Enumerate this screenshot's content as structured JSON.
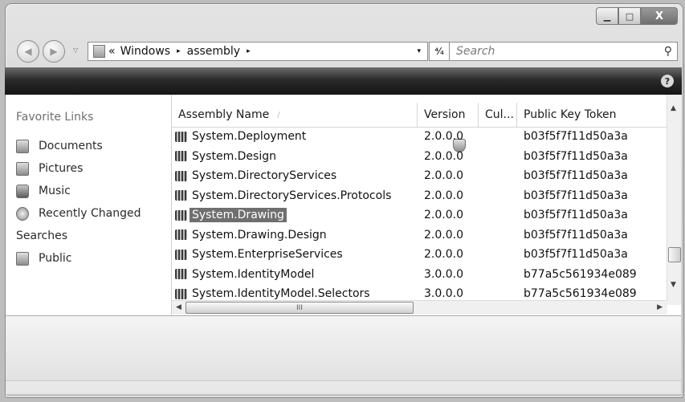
{
  "window": {
    "controls": {
      "minimize": "▁",
      "maximize": "□",
      "close": "X"
    }
  },
  "nav": {
    "back_glyph": "◀",
    "forward_glyph": "▶",
    "recent_glyph": "▽",
    "address": {
      "prefix": "«",
      "crumbs": [
        "Windows",
        "assembly"
      ],
      "separator": "▸",
      "dropdown": "▾"
    },
    "refresh_glyph": "⁴⁄₄",
    "search": {
      "placeholder": "Search",
      "icon": "⚲"
    }
  },
  "toolbar": {
    "help": "?"
  },
  "sidebar": {
    "title": "Favorite Links",
    "items": [
      {
        "label": "Documents",
        "icon": "documents-icon"
      },
      {
        "label": "Pictures",
        "icon": "pictures-icon"
      },
      {
        "label": "Music",
        "icon": "music-icon"
      },
      {
        "label": "Recently Changed",
        "icon": "recently-changed-icon"
      },
      {
        "label": "Searches",
        "icon": "searches-icon"
      },
      {
        "label": "Public",
        "icon": "public-icon"
      }
    ]
  },
  "list": {
    "columns": [
      "Assembly Name",
      "Version",
      "Cul...",
      "Public Key Token"
    ],
    "sort_indicator": "/",
    "rows": [
      {
        "name": "System.Deployment",
        "version": "2.0.0.0",
        "culture": "",
        "token": "b03f5f7f11d50a3a"
      },
      {
        "name": "System.Design",
        "version": "2.0.0.0",
        "culture": "",
        "token": "b03f5f7f11d50a3a"
      },
      {
        "name": "System.DirectoryServices",
        "version": "2.0.0.0",
        "culture": "",
        "token": "b03f5f7f11d50a3a"
      },
      {
        "name": "System.DirectoryServices.Protocols",
        "version": "2.0.0.0",
        "culture": "",
        "token": "b03f5f7f11d50a3a"
      },
      {
        "name": "System.Drawing",
        "version": "2.0.0.0",
        "culture": "",
        "token": "b03f5f7f11d50a3a",
        "selected": true
      },
      {
        "name": "System.Drawing.Design",
        "version": "2.0.0.0",
        "culture": "",
        "token": "b03f5f7f11d50a3a"
      },
      {
        "name": "System.EnterpriseServices",
        "version": "2.0.0.0",
        "culture": "",
        "token": "b03f5f7f11d50a3a"
      },
      {
        "name": "System.IdentityModel",
        "version": "3.0.0.0",
        "culture": "",
        "token": "b77a5c561934e089"
      },
      {
        "name": "System.IdentityModel.Selectors",
        "version": "3.0.0.0",
        "culture": "",
        "token": "b77a5c561934e089"
      }
    ]
  },
  "scroll": {
    "up": "▲",
    "down": "▼",
    "left": "◀",
    "right": "▶",
    "grip": "III"
  },
  "colors": {
    "selection": "#6f6f6f",
    "toolbar": "#1e1e1e"
  }
}
